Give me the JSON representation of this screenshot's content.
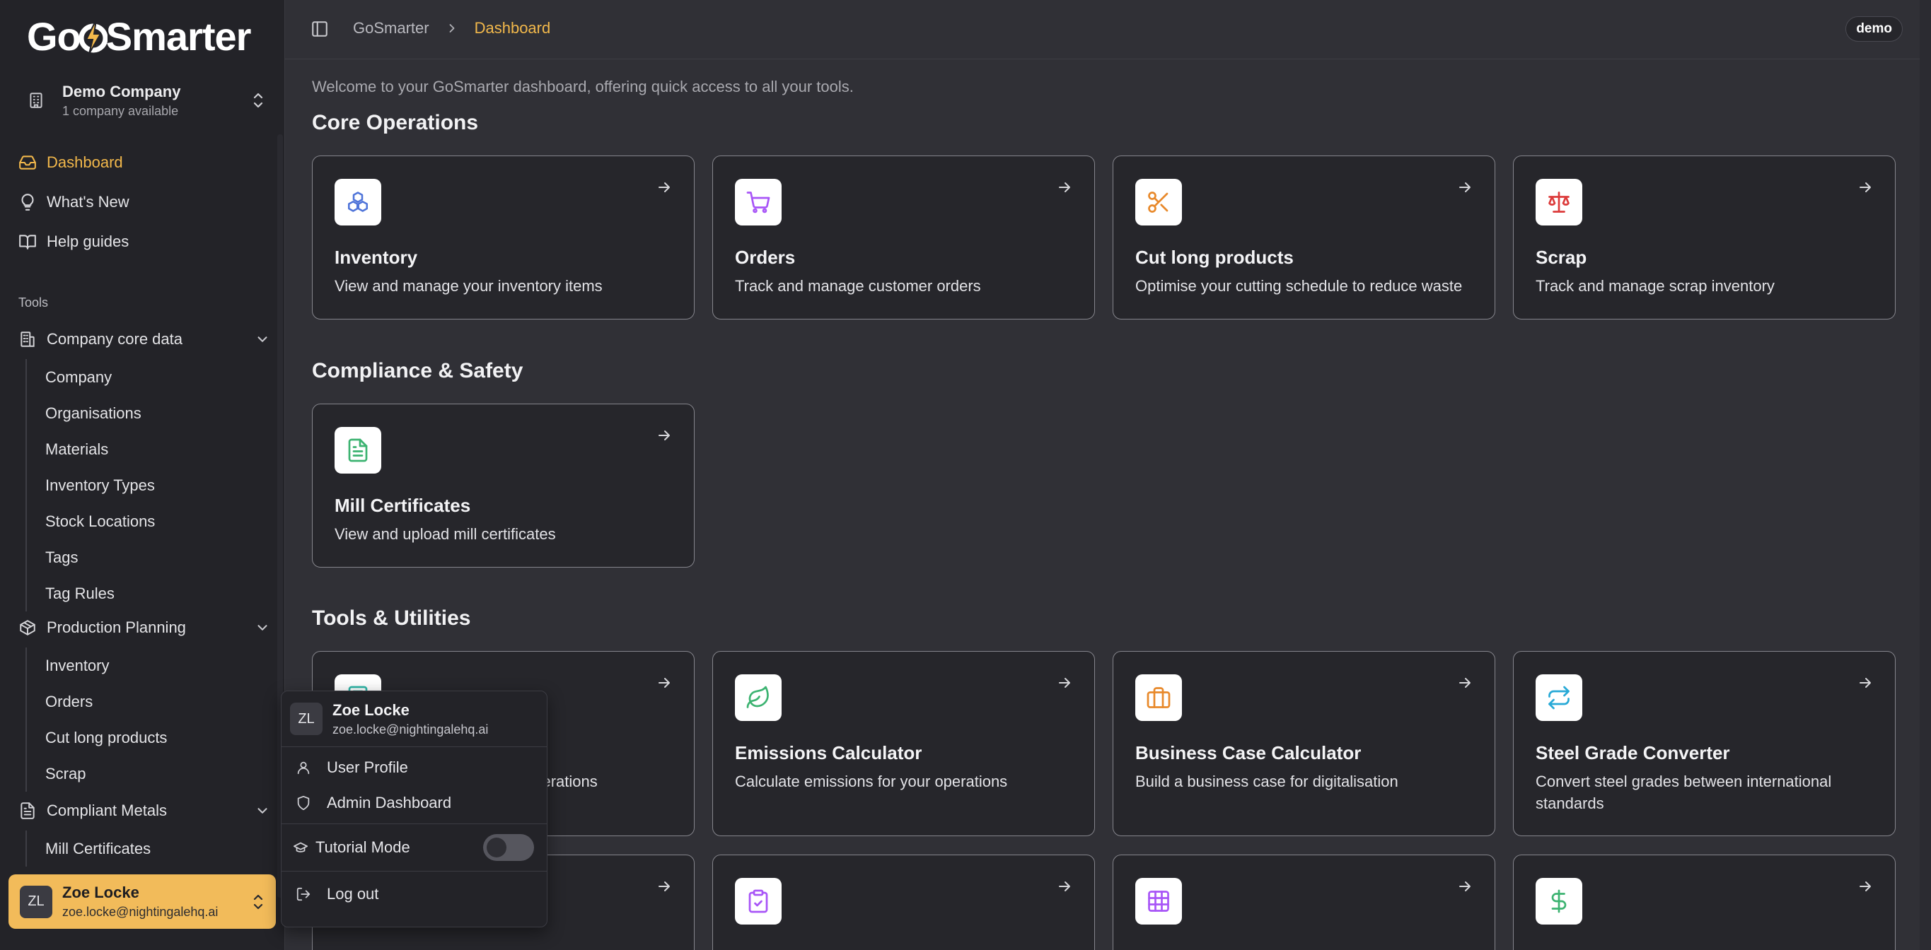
{
  "brand": {
    "logo_pre": "Go",
    "logo_post": "Smarter",
    "accent": "#f2b84b"
  },
  "company": {
    "name": "Demo Company",
    "subtitle": "1 company available"
  },
  "nav": {
    "top": [
      {
        "label": "Dashboard",
        "icon": "inbox-icon",
        "active": true
      },
      {
        "label": "What's New",
        "icon": "lightbulb-icon"
      },
      {
        "label": "Help guides",
        "icon": "book-open-icon"
      }
    ],
    "section_label": "Tools",
    "groups": [
      {
        "label": "Company core data",
        "icon": "building-icon",
        "items": [
          "Company",
          "Organisations",
          "Materials",
          "Inventory Types",
          "Stock Locations",
          "Tags",
          "Tag Rules"
        ]
      },
      {
        "label": "Production Planning",
        "icon": "package-icon",
        "items": [
          "Inventory",
          "Orders",
          "Cut long products",
          "Scrap"
        ]
      },
      {
        "label": "Compliant Metals",
        "icon": "file-text-icon",
        "items": [
          "Mill Certificates"
        ]
      }
    ]
  },
  "user": {
    "initials": "ZL",
    "name": "Zoe Locke",
    "email": "zoe.locke@nightingalehq.ai"
  },
  "header": {
    "breadcrumb_root": "GoSmarter",
    "breadcrumb_current": "Dashboard",
    "env_badge": "demo"
  },
  "main": {
    "welcome": "Welcome to your GoSmarter dashboard, offering quick access to all your tools.",
    "sections": [
      {
        "title": "Core Operations",
        "cards": [
          {
            "title": "Inventory",
            "desc": "View and manage your inventory items",
            "icon": "boxes-icon",
            "color": "#4f74d9"
          },
          {
            "title": "Orders",
            "desc": "Track and manage customer orders",
            "icon": "shopping-cart-icon",
            "color": "#a855f7"
          },
          {
            "title": "Cut long products",
            "desc": "Optimise your cutting schedule to reduce waste",
            "icon": "scissors-icon",
            "color": "#e8892b"
          },
          {
            "title": "Scrap",
            "desc": "Track and manage scrap inventory",
            "icon": "scale-icon",
            "color": "#dc3b3b"
          }
        ]
      },
      {
        "title": "Compliance & Safety",
        "cards": [
          {
            "title": "Mill Certificates",
            "desc": "View and upload mill certificates",
            "icon": "file-text-icon",
            "color": "#3cb371"
          }
        ]
      },
      {
        "title": "Tools & Utilities",
        "cards": [
          {
            "title": "",
            "desc": "operations",
            "icon": "calculator-icon",
            "color": "#2fb6a8"
          },
          {
            "title": "Emissions Calculator",
            "desc": "Calculate emissions for your operations",
            "icon": "leaf-icon",
            "color": "#3cb371"
          },
          {
            "title": "Business Case Calculator",
            "desc": "Build a business case for digitalisation",
            "icon": "briefcase-icon",
            "color": "#e8892b"
          },
          {
            "title": "Steel Grade Converter",
            "desc": "Convert steel grades between international standards",
            "icon": "repeat-icon",
            "color": "#27a9d6"
          },
          {
            "title": "",
            "desc": "",
            "icon": "weight-icon",
            "color": "#2fb6a8"
          },
          {
            "title": "",
            "desc": "",
            "icon": "clipboard-check-icon",
            "color": "#a855f7"
          },
          {
            "title": "",
            "desc": "",
            "icon": "grid-icon",
            "color": "#a855f7"
          },
          {
            "title": "",
            "desc": "",
            "icon": "dollar-icon",
            "color": "#3cb371"
          }
        ]
      }
    ]
  },
  "user_menu": {
    "items": [
      "User Profile",
      "Admin Dashboard"
    ],
    "tutorial_label": "Tutorial Mode",
    "tutorial_on": false,
    "logout_label": "Log out"
  }
}
